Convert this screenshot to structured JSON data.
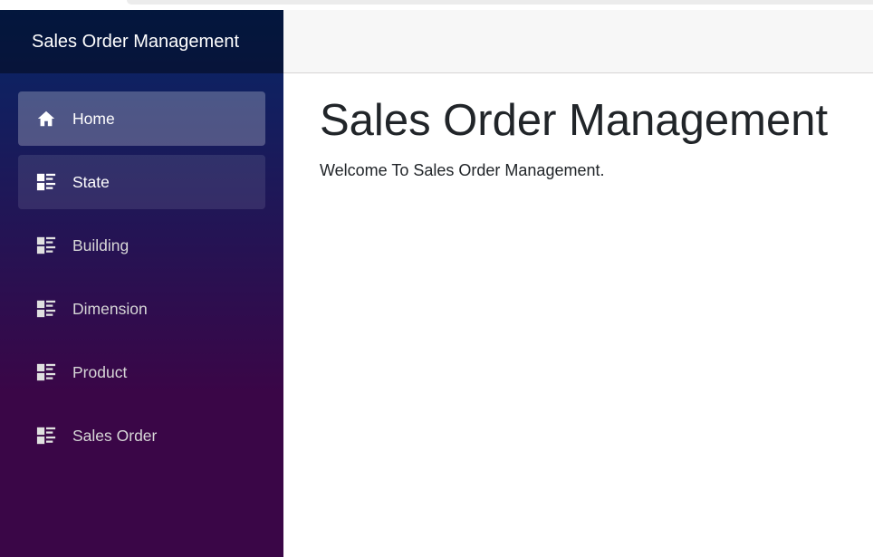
{
  "app": {
    "title": "Sales Order Management"
  },
  "sidebar": {
    "items": [
      {
        "label": "Home",
        "icon": "home-icon",
        "state": "active"
      },
      {
        "label": "State",
        "icon": "list-icon",
        "state": "hovered"
      },
      {
        "label": "Building",
        "icon": "list-icon",
        "state": "normal"
      },
      {
        "label": "Dimension",
        "icon": "list-icon",
        "state": "normal"
      },
      {
        "label": "Product",
        "icon": "list-icon",
        "state": "normal"
      },
      {
        "label": "Sales Order",
        "icon": "list-icon",
        "state": "normal"
      }
    ]
  },
  "main": {
    "heading": "Sales Order Management",
    "welcome": "Welcome To Sales Order Management."
  },
  "colors": {
    "sidebar_top": "#052767",
    "sidebar_bottom": "#3a0647",
    "text": "#212529"
  }
}
